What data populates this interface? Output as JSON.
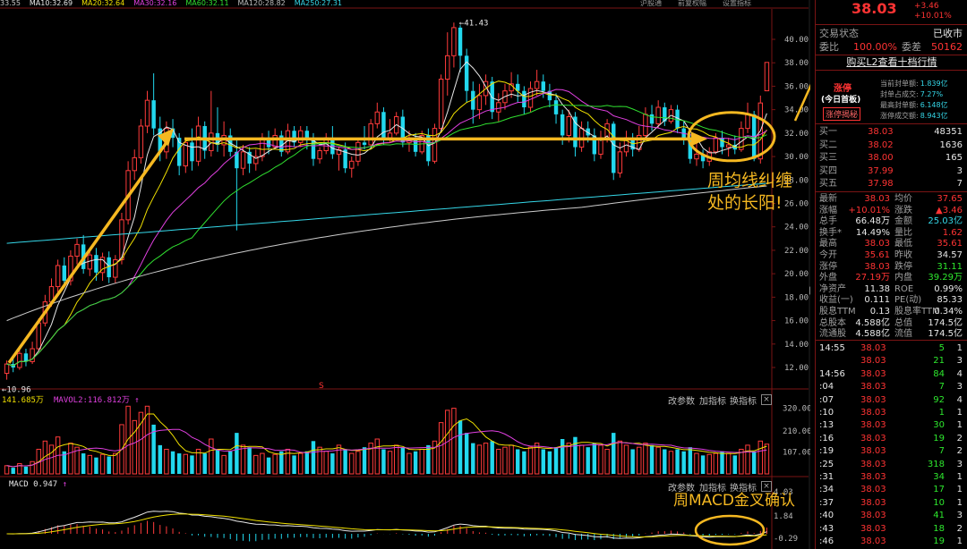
{
  "top_bar": {
    "ma_labels": [
      {
        "text": "33.55",
        "color": "#c8c8c8"
      },
      {
        "text": "MA10:32.69",
        "color": "#e8e8e8"
      },
      {
        "text": "MA20:32.64",
        "color": "#f0e000"
      },
      {
        "text": "MA30:32.16",
        "color": "#e040e0"
      },
      {
        "text": "MA60:32.11",
        "color": "#30e030"
      },
      {
        "text": "MA120:28.82",
        "color": "#bbbbbb"
      },
      {
        "text": "MA250:27.31",
        "color": "#35d7e8"
      }
    ],
    "right_tabs": [
      "沪股通",
      "前复权幅",
      "设置指标"
    ]
  },
  "price_axis": [
    "40.00",
    "38.00",
    "36.00",
    "34.00",
    "32.00",
    "30.00",
    "28.00",
    "26.00",
    "24.00",
    "22.00",
    "20.00",
    "18.00",
    "16.00",
    "14.00",
    "12.00"
  ],
  "max_label": "41.43",
  "min_label": "10.96",
  "s_marker": "S",
  "volume": {
    "label1": "141.685万",
    "label2": "MAVOL2:116.812万",
    "axis": [
      "320.00",
      "210.00",
      "107.00"
    ],
    "buttons": [
      "改参数",
      "加指标",
      "换指标"
    ],
    "close": "×"
  },
  "macd": {
    "label": "MACD 0.947",
    "axis": [
      "4.03",
      "1.84",
      "-0.29"
    ],
    "buttons": [
      "改参数",
      "加指标",
      "换指标"
    ],
    "close": "×"
  },
  "annotations": {
    "main_note_line1": "周均线纠缠",
    "main_note_line2": "处的长阳!",
    "macd_note": "周MACD金叉确认"
  },
  "quote": {
    "price": "38.03",
    "change": "+3.46",
    "change_pct": "+10.01%",
    "trade_state_label": "交易状态",
    "trade_state_value": "已收市",
    "weibi_label": "委比",
    "weibi_value": "100.00%",
    "weicha_label": "委差",
    "weicha_value": "50162",
    "l2_link": "购买L2查看十档行情",
    "limit_title": "涨停",
    "limit_sub": "(今日首板)",
    "limit_badge": "涨停揭秘",
    "limit_stats": [
      {
        "label": "当前封单额:",
        "value": "1.839亿"
      },
      {
        "label": "封单占成交:",
        "value": "7.27%"
      },
      {
        "label": "最高封单额:",
        "value": "6.148亿"
      },
      {
        "label": "涨停成交额:",
        "value": "8.943亿"
      }
    ],
    "order_book": [
      {
        "label": "买一",
        "price": "38.03",
        "vol": "48351"
      },
      {
        "label": "买二",
        "price": "38.02",
        "vol": "1636"
      },
      {
        "label": "买三",
        "price": "38.00",
        "vol": "165"
      },
      {
        "label": "买四",
        "price": "37.99",
        "vol": "3"
      },
      {
        "label": "买五",
        "price": "37.98",
        "vol": "7"
      }
    ],
    "stats": [
      {
        "l1": "最新",
        "v1": "38.03",
        "c1": "red",
        "l2": "均价",
        "v2": "37.65",
        "c2": "red"
      },
      {
        "l1": "涨幅",
        "v1": "+10.01%",
        "c1": "red",
        "l2": "涨跌",
        "v2": "▲3.46",
        "c2": "red"
      },
      {
        "l1": "总手",
        "v1": "66.48万",
        "c1": "white",
        "l2": "金额",
        "v2": "25.03亿",
        "c2": "cyan"
      },
      {
        "l1": "换手*",
        "v1": "14.49%",
        "c1": "white",
        "l2": "量比",
        "v2": "1.62",
        "c2": "red"
      },
      {
        "l1": "最高",
        "v1": "38.03",
        "c1": "red",
        "l2": "最低",
        "v2": "35.61",
        "c2": "red"
      },
      {
        "l1": "今开",
        "v1": "35.61",
        "c1": "red",
        "l2": "昨收",
        "v2": "34.57",
        "c2": "white"
      },
      {
        "l1": "涨停",
        "v1": "38.03",
        "c1": "red",
        "l2": "跌停",
        "v2": "31.11",
        "c2": "green"
      },
      {
        "l1": "外盘",
        "v1": "27.19万",
        "c1": "red",
        "l2": "内盘",
        "v2": "39.29万",
        "c2": "green"
      },
      {
        "l1": "净资产",
        "v1": "11.38",
        "c1": "white",
        "l2": "ROE",
        "v2": "0.99%",
        "c2": "white"
      },
      {
        "l1": "收益(一)",
        "v1": "0.111",
        "c1": "white",
        "l2": "PE(动)",
        "v2": "85.33",
        "c2": "white"
      },
      {
        "l1": "股息TTM",
        "v1": "0.13",
        "c1": "white",
        "l2": "股息率TTM",
        "v2": "0.34%",
        "c2": "white"
      },
      {
        "l1": "总股本",
        "v1": "4.588亿",
        "c1": "white",
        "l2": "总值",
        "v2": "174.5亿",
        "c2": "white"
      },
      {
        "l1": "流通股",
        "v1": "4.588亿",
        "c1": "white",
        "l2": "流值",
        "v2": "174.5亿",
        "c2": "white"
      }
    ],
    "ticks": [
      {
        "t": "14:55",
        "p": "38.03",
        "v": "5",
        "n": "1",
        "vc": "green"
      },
      {
        "t": "",
        "p": "38.03",
        "v": "21",
        "n": "3",
        "vc": "green"
      },
      {
        "t": "14:56",
        "p": "38.03",
        "v": "84",
        "n": "4",
        "vc": "green"
      },
      {
        "t": ":04",
        "p": "38.03",
        "v": "7",
        "n": "3",
        "vc": "green"
      },
      {
        "t": ":07",
        "p": "38.03",
        "v": "92",
        "n": "4",
        "vc": "green"
      },
      {
        "t": ":10",
        "p": "38.03",
        "v": "1",
        "n": "1",
        "vc": "green"
      },
      {
        "t": ":13",
        "p": "38.03",
        "v": "30",
        "n": "1",
        "vc": "green"
      },
      {
        "t": ":16",
        "p": "38.03",
        "v": "19",
        "n": "2",
        "vc": "green"
      },
      {
        "t": ":19",
        "p": "38.03",
        "v": "7",
        "n": "2",
        "vc": "green"
      },
      {
        "t": ":25",
        "p": "38.03",
        "v": "318",
        "n": "3",
        "vc": "green"
      },
      {
        "t": ":31",
        "p": "38.03",
        "v": "34",
        "n": "1",
        "vc": "green"
      },
      {
        "t": ":34",
        "p": "38.03",
        "v": "17",
        "n": "1",
        "vc": "green"
      },
      {
        "t": ":37",
        "p": "38.03",
        "v": "10",
        "n": "1",
        "vc": "green"
      },
      {
        "t": ":40",
        "p": "38.03",
        "v": "41",
        "n": "3",
        "vc": "green"
      },
      {
        "t": ":43",
        "p": "38.03",
        "v": "18",
        "n": "2",
        "vc": "green"
      },
      {
        "t": ":46",
        "p": "38.03",
        "v": "19",
        "n": "1",
        "vc": "green"
      }
    ]
  },
  "colors": {
    "up": "#ff3b3b",
    "down": "#22d8ee",
    "accent": "#f5b821",
    "border": "#7a1414"
  }
}
